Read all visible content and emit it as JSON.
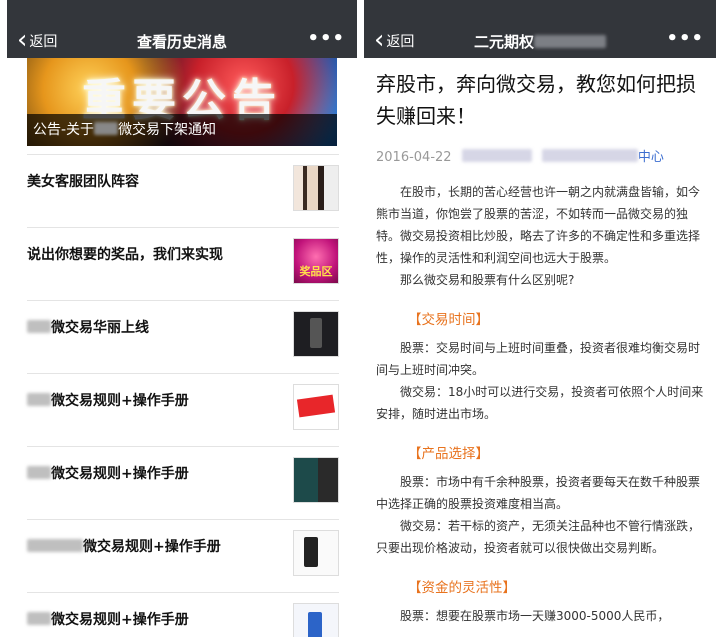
{
  "left": {
    "nav": {
      "back_label": "返回",
      "title": "查看历史消息",
      "more": "•••"
    },
    "banner": {
      "big_text": "重要公告",
      "caption_prefix": "公告-关于",
      "caption_suffix": "微交易下架通知"
    },
    "items": [
      {
        "title": "美女客服团队阵容",
        "thumb": "photo-people"
      },
      {
        "title": "说出你想要的奖品，我们来实现",
        "thumb": "prize-zone",
        "thumb_text": "奖品区"
      },
      {
        "title": "微交易华丽上线",
        "thumb": "phone-dark"
      },
      {
        "title": "微交易规则+操作手册",
        "thumb": "red-banner"
      },
      {
        "title": "微交易规则+操作手册",
        "thumb": "slide-teal"
      },
      {
        "title": "微交易规则+操作手册",
        "thumb": "phone-white"
      },
      {
        "title": "微交易规则+操作手册",
        "thumb": "phone-blue"
      }
    ]
  },
  "right": {
    "nav": {
      "back_label": "返回",
      "title": "二元期权",
      "more": "•••"
    },
    "article": {
      "title": "弃股市，奔向微交易，教您如何把损失赚回来！",
      "date": "2016-04-22",
      "author_suffix": "中心",
      "paragraphs": [
        "在股市，长期的苦心经营也许一朝之内就满盘皆输，如今熊市当道，你饱尝了股票的苦涩，不如转而一品微交易的独特。微交易投资相比炒股，略去了许多的不确定性和多重选择性，操作的灵活性和利润空间也远大于股票。",
        "那么微交易和股票有什么区别呢?"
      ],
      "sections": [
        {
          "heading": "【交易时间】",
          "paragraphs": [
            "股票：交易时间与上班时间重叠，投资者很难均衡交易时间与上班时间冲突。",
            "微交易：18小时可以进行交易，投资者可依照个人时间来安排，随时进出市场。"
          ]
        },
        {
          "heading": "【产品选择】",
          "paragraphs": [
            "股票：市场中有千余种股票，投资者要每天在数千种股票中选择正确的股票投资难度相当高。",
            "微交易：若干标的资产，无须关注品种也不管行情涨跌，只要出现价格波动，投资者就可以很快做出交易判断。"
          ]
        },
        {
          "heading": "【资金的灵活性】",
          "paragraphs": [
            "股票：想要在股票市场一天赚3000-5000人民币，"
          ]
        }
      ]
    }
  },
  "colors": {
    "navbar": "#33363b",
    "section_head": "#e8731e",
    "link": "#3c6ed0"
  }
}
